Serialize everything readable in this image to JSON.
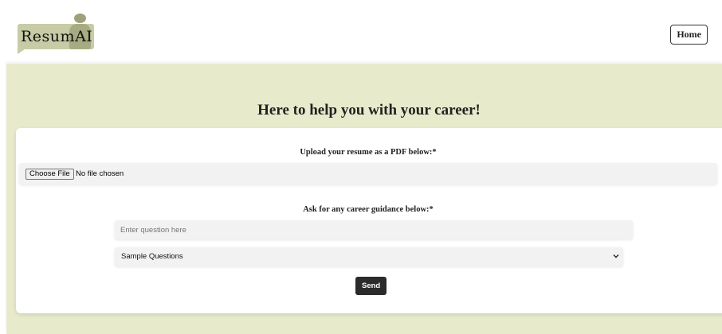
{
  "header": {
    "logo": {
      "text_part1": "Resum",
      "text_part2": "AI"
    },
    "home_label": "Home"
  },
  "main": {
    "title": "Here to help you with your career!",
    "upload": {
      "label": "Upload your resume as a PDF below:*",
      "choose_button": "Choose File",
      "status": "No file chosen"
    },
    "guidance": {
      "label": "Ask for any career guidance below:*",
      "question_placeholder": "Enter question here",
      "sample_selected": "Sample Questions",
      "send_label": "Send"
    }
  },
  "colors": {
    "main_bg": "#e8ebcb",
    "logo_bubble": "#c8cca6",
    "send_bg": "#2b2b2b"
  }
}
